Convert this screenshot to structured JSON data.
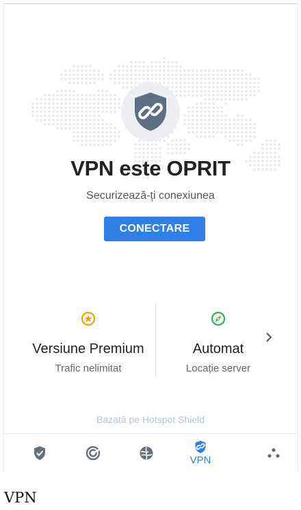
{
  "status": {
    "title": "VPN este OPRIT",
    "subtitle": "Securizează-ți conexiunea",
    "connect_label": "CONECTARE"
  },
  "cards": {
    "premium": {
      "title": "Versiune Premium",
      "subtitle": "Trafic nelimitat",
      "icon": "star-badge-icon"
    },
    "location": {
      "title": "Automat",
      "subtitle": "Locație server",
      "icon": "compass-icon"
    }
  },
  "powered_by": "Bazată pe Hotspot Shield",
  "nav": {
    "items": [
      {
        "name": "security",
        "icon": "shield-check-icon",
        "label": ""
      },
      {
        "name": "scan",
        "icon": "scan-icon",
        "label": ""
      },
      {
        "name": "web",
        "icon": "web-protection-icon",
        "label": ""
      },
      {
        "name": "vpn",
        "icon": "vpn-shield-icon",
        "label": "VPN",
        "active": true
      },
      {
        "name": "more",
        "icon": "more-dots-icon",
        "label": ""
      }
    ]
  },
  "footer_label": "VPN",
  "colors": {
    "accent": "#2f7fe6",
    "shield": "#5f6f82",
    "premium": "#f0a000",
    "location": "#2eb24d",
    "nav_icon": "#66707c"
  }
}
